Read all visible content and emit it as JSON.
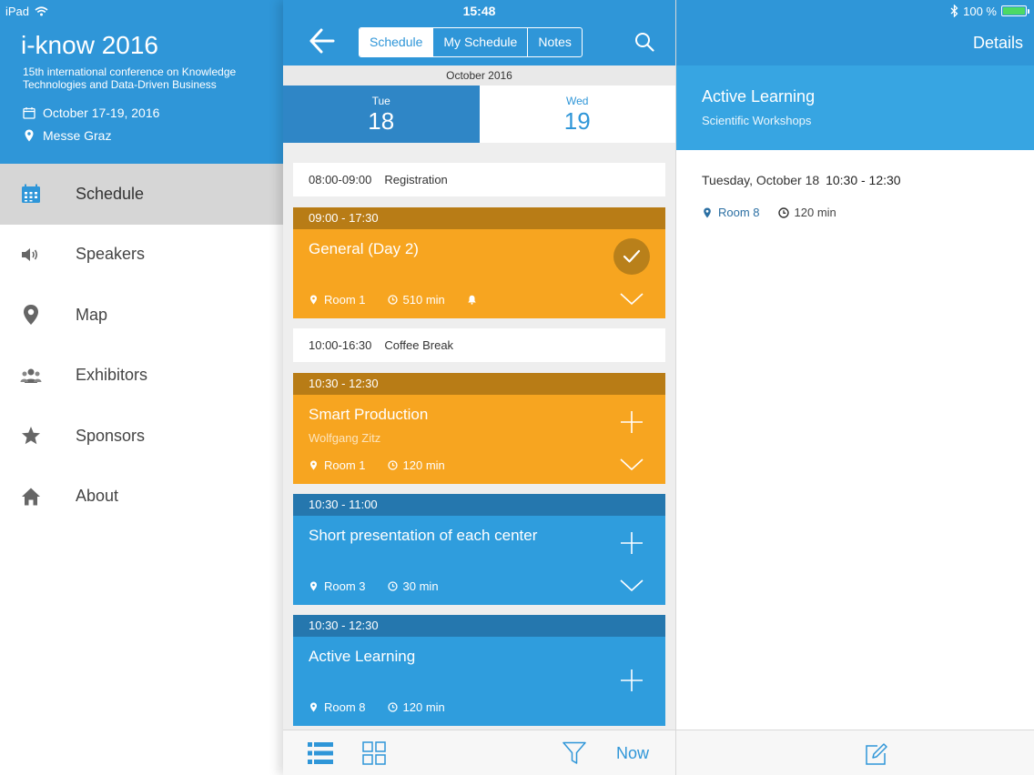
{
  "status_bar": {
    "device": "iPad",
    "time": "15:48",
    "battery": "100 %",
    "battery_level": 1.0
  },
  "sidebar": {
    "app_title": "i-know 2016",
    "subtitle": "15th international conference on Knowledge Technologies and Data-Driven Business",
    "dates": "October 17-19, 2016",
    "venue": "Messe Graz",
    "items": [
      {
        "label": "Schedule",
        "icon": "calendar-icon",
        "active": true
      },
      {
        "label": "Speakers",
        "icon": "speaker-icon",
        "active": false
      },
      {
        "label": "Map",
        "icon": "map-pin-icon",
        "active": false
      },
      {
        "label": "Exhibitors",
        "icon": "people-icon",
        "active": false
      },
      {
        "label": "Sponsors",
        "icon": "star-icon",
        "active": false
      },
      {
        "label": "About",
        "icon": "home-icon",
        "active": false
      }
    ]
  },
  "schedule": {
    "tabs": [
      {
        "label": "Schedule",
        "selected": true
      },
      {
        "label": "My Schedule",
        "selected": false
      },
      {
        "label": "Notes",
        "selected": false
      }
    ],
    "month": "October 2016",
    "days": [
      {
        "name": "Tue",
        "num": "18",
        "selected": true
      },
      {
        "name": "Wed",
        "num": "19",
        "selected": false
      }
    ],
    "entries": [
      {
        "kind": "plain",
        "time": "08:00-09:00",
        "title": "Registration"
      },
      {
        "kind": "card",
        "color": "orange",
        "time": "09:00 - 17:30",
        "title": "General (Day 2)",
        "speaker": "",
        "room": "Room 1",
        "duration": "510 min",
        "bell": true,
        "action": "check",
        "chevron": true
      },
      {
        "kind": "plain",
        "time": "10:00-16:30",
        "title": "Coffee Break"
      },
      {
        "kind": "card",
        "color": "orange",
        "time": "10:30 - 12:30",
        "title": "Smart Production",
        "speaker": "Wolfgang Zitz",
        "room": "Room 1",
        "duration": "120 min",
        "bell": false,
        "action": "plus",
        "chevron": true
      },
      {
        "kind": "card",
        "color": "blue",
        "time": "10:30 - 11:00",
        "title": "Short presentation of each center",
        "speaker": "",
        "room": "Room 3",
        "duration": "30 min",
        "bell": false,
        "action": "plus",
        "chevron": true
      },
      {
        "kind": "card",
        "color": "blue",
        "time": "10:30 - 12:30",
        "title": "Active Learning",
        "speaker": "",
        "room": "Room 8",
        "duration": "120 min",
        "bell": false,
        "action": "plus",
        "chevron": false
      }
    ],
    "toolbar": {
      "now_label": "Now"
    }
  },
  "details": {
    "header_title": "Details",
    "title": "Active Learning",
    "category": "Scientific Workshops",
    "date": "Tuesday, October 18",
    "time": "10:30 - 12:30",
    "room": "Room 8",
    "duration": "120 min"
  },
  "colors": {
    "primary": "#2f96d8",
    "orange": "#f7a520",
    "orange_dark": "#b87c16",
    "blue": "#2f9ddd",
    "blue_dark": "#2577ae"
  }
}
